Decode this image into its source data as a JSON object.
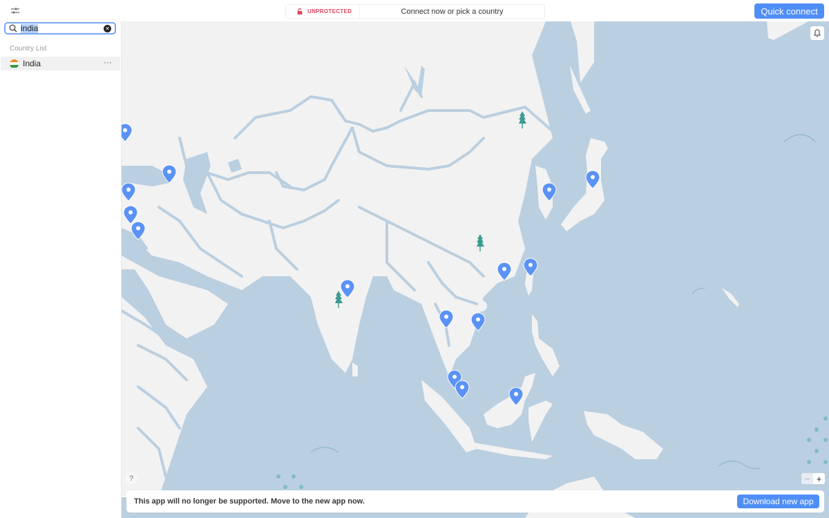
{
  "topbar": {
    "status_label": "UNPROTECTED",
    "status_message": "Connect now or pick a country",
    "quick_connect_label": "Quick connect"
  },
  "sidebar": {
    "search": {
      "value": "india",
      "placeholder": "Search"
    },
    "section_label": "Country List",
    "countries": [
      {
        "name": "India",
        "flag": "india-flag-icon",
        "more": "···"
      }
    ]
  },
  "map": {
    "help_label": "?",
    "zoom_out_label": "−",
    "zoom_in_label": "+",
    "colors": {
      "ocean": "#bacfe0",
      "land": "#f2f2f2",
      "pin": "#5b92f5",
      "tree": "#3b9a92",
      "accent": "#4f8ef7",
      "unprotected": "#e0455f"
    }
  },
  "banner": {
    "message": "This app will no longer be supported. Move to the new app now.",
    "download_label": "Download new app"
  }
}
